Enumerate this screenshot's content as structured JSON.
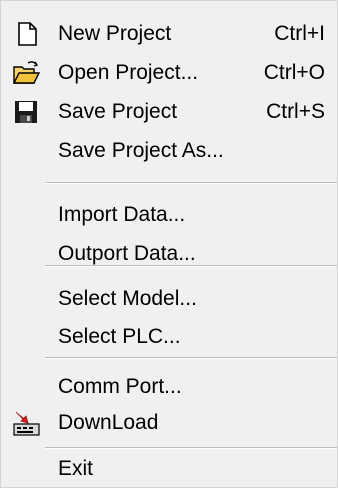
{
  "menu": {
    "items": [
      {
        "label": "New Project",
        "shortcut": "Ctrl+I",
        "icon": "new-document-icon"
      },
      {
        "label": "Open Project...",
        "shortcut": "Ctrl+O",
        "icon": "open-folder-icon"
      },
      {
        "label": "Save Project",
        "shortcut": "Ctrl+S",
        "icon": "floppy-disk-icon"
      },
      {
        "label": "Save Project As...",
        "shortcut": ""
      },
      {
        "label": "Import Data..."
      },
      {
        "label": "Outport Data..."
      },
      {
        "label": "Select Model..."
      },
      {
        "label": "Select PLC..."
      },
      {
        "label": "Comm Port..."
      },
      {
        "label": "DownLoad",
        "icon": "download-icon"
      },
      {
        "label": "Exit"
      }
    ],
    "colors": {
      "background": "#f0f0f0",
      "separator": "#bcbcbc",
      "text": "#000000",
      "icon_red": "#e02020",
      "icon_yellow": "#f2c23a"
    }
  }
}
